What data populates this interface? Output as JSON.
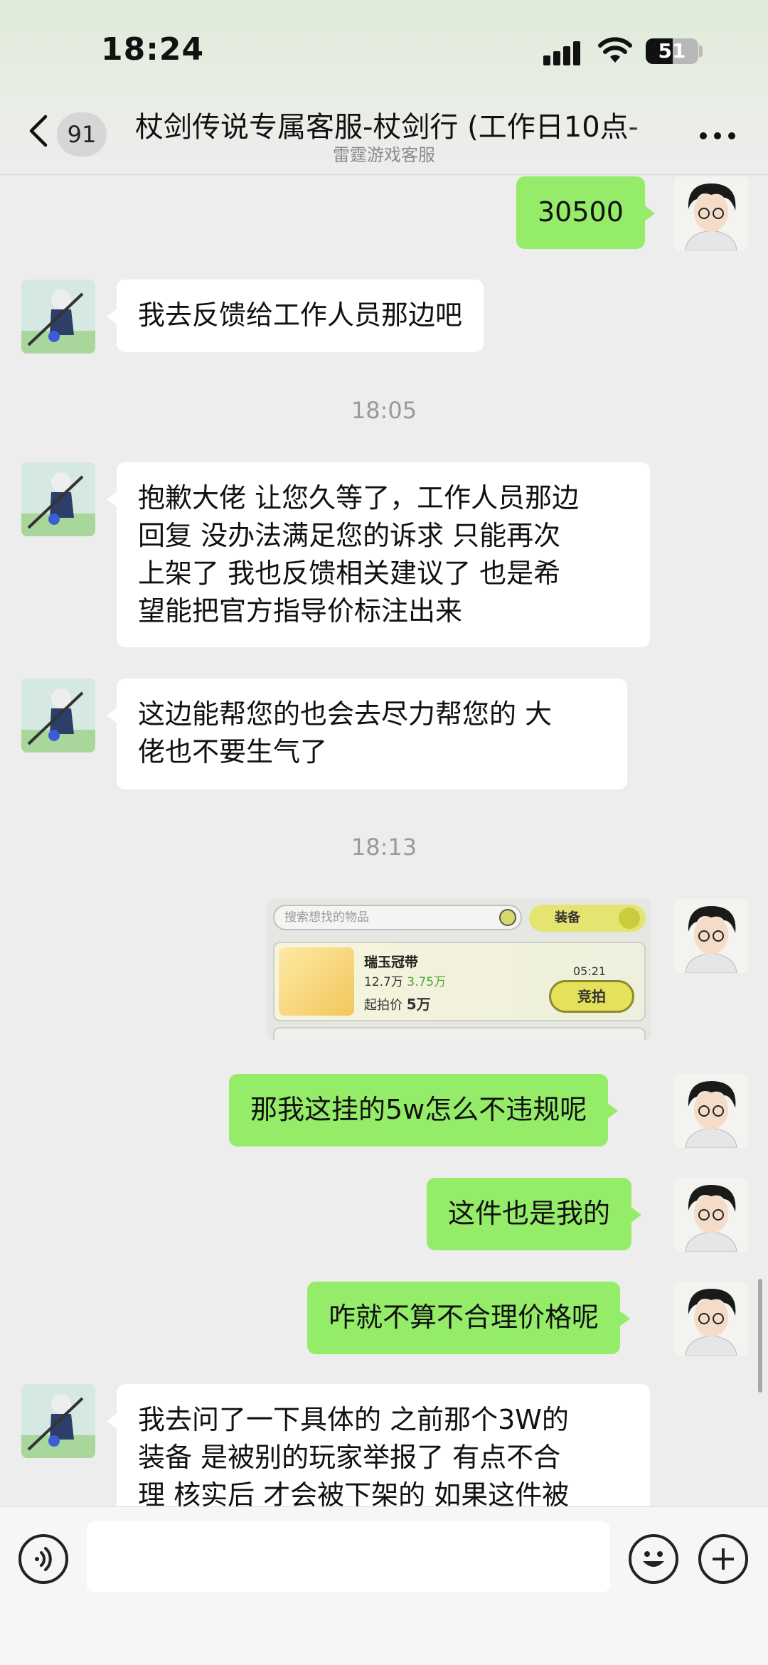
{
  "status_bar": {
    "time": "18:24",
    "battery": "51",
    "battery_level": 0.51
  },
  "header": {
    "unread_count": "91",
    "title": "杖剑传说专属客服-杖剑行 (工作日10点-",
    "subtitle": "雷霆游戏客服"
  },
  "messages": [
    {
      "from": "me",
      "text": "30500"
    },
    {
      "from": "cs",
      "lines": [
        "我去反馈给工作人员那边吧"
      ]
    },
    {
      "timestamp": "18:05"
    },
    {
      "from": "cs",
      "lines": [
        "抱歉大佬 让您久等了，工作人员那边",
        "回复 没办法满足您的诉求 只能再次",
        "上架了  我也反馈相关建议了 也是希",
        "望能把官方指导价标注出来"
      ]
    },
    {
      "from": "cs",
      "lines": [
        "这边能帮您的也会去尽力帮您的  大",
        "佬也不要生气了"
      ]
    },
    {
      "timestamp": "18:13"
    },
    {
      "from": "me",
      "type": "image"
    },
    {
      "from": "me",
      "text": "那我这挂的5w怎么不违规呢"
    },
    {
      "from": "me",
      "text": "这件也是我的"
    },
    {
      "from": "me",
      "text": "咋就不算不合理价格呢"
    },
    {
      "from": "cs",
      "lines": [
        "我去问了一下具体的  之前那个3W的",
        "装备 是被别的玩家举报了 有点不合",
        "理 核实后 才会被下架的 如果这件被"
      ]
    }
  ],
  "shared_image": {
    "search_placeholder": "搜索想找的物品",
    "filter_label": "装备",
    "item_name": "瑞玉冠带",
    "item_price": "12.7万",
    "item_change": "3.75万",
    "start_price_label": "起拍价",
    "start_price": "5万",
    "timer": "05:21",
    "bid_button": "竞拍"
  }
}
